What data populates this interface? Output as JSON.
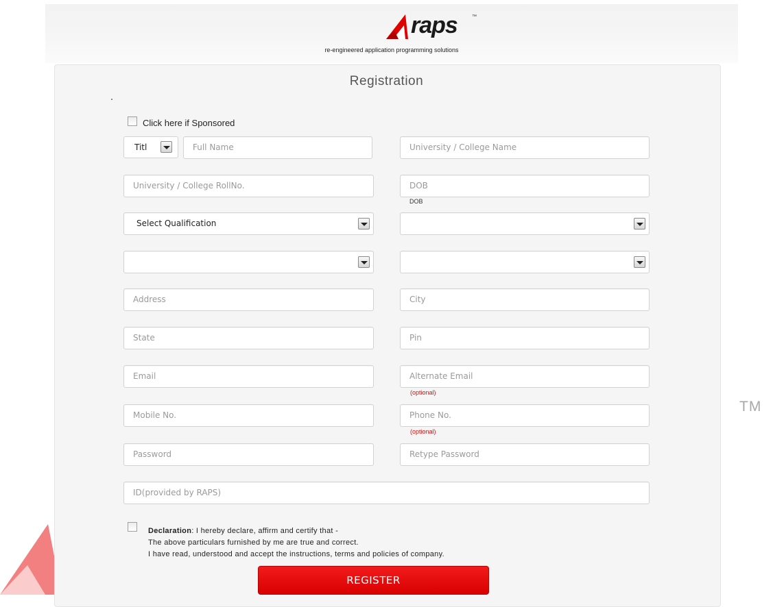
{
  "brand": {
    "name": "raps",
    "trademark": "™",
    "tagline": "re-engineered application programming solutions",
    "accent_color": "#e00000",
    "watermark_tm": "TM"
  },
  "form": {
    "title": "Registration",
    "sponsored_label": "Click here if Sponsored",
    "title_select_value": "Titl",
    "fields": {
      "full_name": "Full Name",
      "university_name": "University / College Name",
      "roll_no": "University / College RollNo.",
      "dob": "DOB",
      "dob_hint": "DOB",
      "qualification": "Select Qualification",
      "address": "Address",
      "city": "City",
      "state": "State",
      "pin": "Pin",
      "email": "Email",
      "alt_email": "Alternate Email",
      "alt_email_hint": "(optional)",
      "mobile": "Mobile No.",
      "phone": "Phone No.",
      "phone_hint": "(optional)",
      "password": "Password",
      "retype_password": "Retype Password",
      "raps_id": "ID(provided by RAPS)"
    },
    "declaration": {
      "heading": "Declaration",
      "line1": ": I hereby declare, affirm and certify that -",
      "line2": "The above particulars furnished by me are true and correct.",
      "line3": "I have read, understood and accept the instructions, terms and policies of company."
    },
    "submit_label": "REGISTER"
  }
}
